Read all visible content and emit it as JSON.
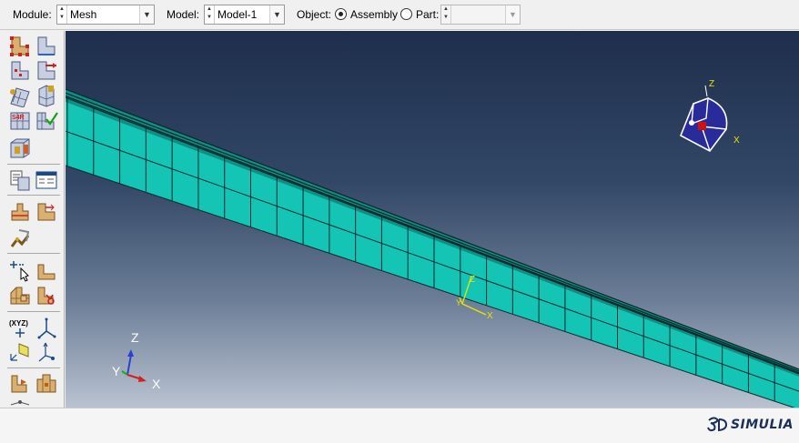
{
  "context_bar": {
    "module_label": "Module:",
    "module_value": "Mesh",
    "model_label": "Model:",
    "model_value": "Model-1",
    "object_label": "Object:",
    "assembly_label": "Assembly",
    "part_label": "Part:",
    "part_value": "",
    "object_selected": "Assembly"
  },
  "toolbox": {
    "icons": [
      "seed-part-icon",
      "seed-edge-icon",
      "seed-by-number-icon",
      "seed-bias-icon",
      "assign-mesh-controls-icon",
      "assign-element-type-icon",
      "mesh-part-icon-s4r",
      "verify-mesh-icon",
      "mesh-region-icon",
      "query-icon",
      "mesh-stats-icon",
      "partition-cell-icon",
      "partition-face-icon",
      "virtual-topology-icon",
      "edit-mesh-icon",
      "create-face-icon",
      "mesh-refine-icon",
      "delete-mesh-icon",
      "datum-point-icon",
      "datum-axis-icon",
      "datum-plane-icon",
      "datum-csys-icon",
      "part-instance-icon",
      "assembly-icon"
    ],
    "datum_label": "(XYZ)"
  },
  "viewport": {
    "triad_labels": {
      "x": "X",
      "y": "Y",
      "z": "Z"
    },
    "csys_labels": {
      "x": "X",
      "y": "Y",
      "z": "Z"
    },
    "view_cube_labels": {
      "x": "X",
      "z": "Z"
    },
    "colors": {
      "mesh_fill": "#14c4b4",
      "mesh_lines": "#0b2a2a",
      "triad_x": "#d02020",
      "triad_y": "#1ea81e",
      "triad_z": "#2b3fd0",
      "csys": "#e6e600"
    }
  },
  "branding": {
    "logo_text": "SIMULIA"
  }
}
